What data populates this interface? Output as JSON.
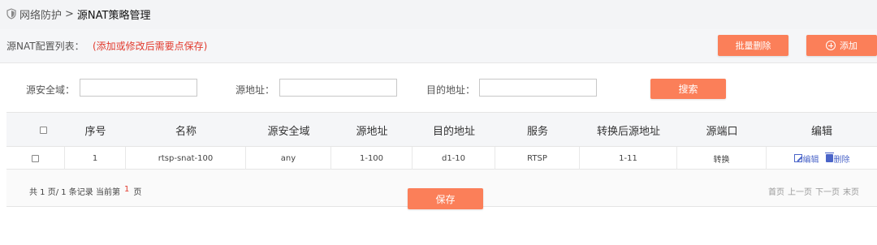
{
  "breadcrumb": {
    "parent": "网络防护",
    "separator": ">",
    "current": "源NAT策略管理"
  },
  "list": {
    "title": "源NAT配置列表：",
    "hint": "(添加或修改后需要点保存)"
  },
  "toolbar": {
    "batch_delete": "批量删除",
    "add": "添加"
  },
  "filters": {
    "src_zone_label": "源安全域：",
    "src_zone_value": "",
    "src_addr_label": "源地址：",
    "src_addr_value": "",
    "dst_addr_label": "目的地址：",
    "dst_addr_value": "",
    "search": "搜索"
  },
  "table": {
    "headers": [
      "序号",
      "名称",
      "源安全域",
      "源地址",
      "目的地址",
      "服务",
      "转换后源地址",
      "源端口",
      "编辑"
    ],
    "rows": [
      {
        "index": "1",
        "name": "rtsp-snat-100",
        "src_zone": "any",
        "src_addr": "1-100",
        "dst_addr": "d1-10",
        "service": "RTSP",
        "translated": "1-11",
        "src_port": "转换",
        "edit": "编辑",
        "delete": "删除"
      }
    ]
  },
  "pager": {
    "summary_prefix": "共 1 页/ 1 条记录 当前第",
    "current_page": "1",
    "summary_suffix": "页",
    "first": "首页",
    "prev": "上一页",
    "next": "下一页",
    "last": "末页"
  },
  "footer": {
    "save": "保存"
  },
  "colors": {
    "accent": "#fb7f59",
    "hint_red": "#e23b2e",
    "link_blue": "#4a64c8"
  }
}
